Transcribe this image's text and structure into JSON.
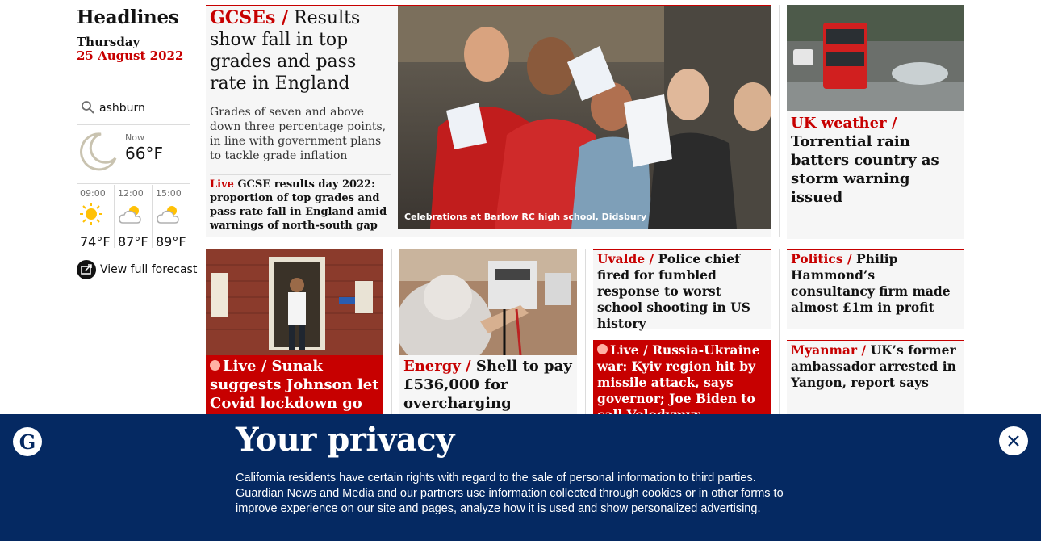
{
  "sidebar": {
    "title": "Headlines",
    "day": "Thursday",
    "date": "25 August 2022",
    "weather": {
      "location": "ashburn",
      "now_label": "Now",
      "now_temp": "66°F",
      "hours": [
        {
          "time": "09:00",
          "temp": "74°F",
          "icon": "sun-icon"
        },
        {
          "time": "12:00",
          "temp": "87°F",
          "icon": "partly-cloudy-icon"
        },
        {
          "time": "15:00",
          "temp": "89°F",
          "icon": "partly-cloudy-icon"
        }
      ],
      "full_forecast": "View full forecast"
    }
  },
  "feature": {
    "kicker": "GCSEs /",
    "headline": "Results show fall in top grades and pass rate in England",
    "standfirst": "Grades of seven and above down three percentage points, in line with government plans to tackle grade inflation",
    "sub_live": "Live",
    "sub_text": "GCSE results day 2022: proportion of top grades and pass rate fall in England amid warnings of north-south gap",
    "caption": "Celebrations at Barlow RC high school, Didsbury"
  },
  "uk_weather": {
    "kicker": "UK weather /",
    "headline": "Torrential rain batters country as storm warning issued"
  },
  "sunak": {
    "live": "Live",
    "kicker_sep": "/",
    "headline": "Sunak suggests Johnson let Covid lockdown go on"
  },
  "energy": {
    "kicker": "Energy /",
    "headline": "Shell to pay £536,000 for overcharging"
  },
  "uvalde": {
    "kicker": "Uvalde /",
    "headline": "Police chief fired for fumbled response to worst school shooting in US history"
  },
  "ukraine": {
    "live": "Live",
    "kicker": "/",
    "headline": "Russia-Ukraine war: Kyiv region hit by missile attack, says governor; Joe Biden to call Volodymyr Zelenskiy"
  },
  "politics": {
    "kicker": "Politics /",
    "headline": "Philip Hammond’s consultancy firm made almost £1m in profit"
  },
  "myanmar": {
    "kicker": "Myanmar /",
    "headline": "UK’s former ambassador arrested in Yangon, report says"
  },
  "privacy": {
    "title": "Your privacy",
    "body": "California residents have certain rights with regard to the sale of personal information to third parties. Guardian News and Media and our partners use information collected through cookies or in other forms to improve experience on our site and pages, analyze how it is used and show personalized advertising."
  },
  "colors": {
    "accent_red": "#c70000",
    "banner_navy": "#052962"
  }
}
